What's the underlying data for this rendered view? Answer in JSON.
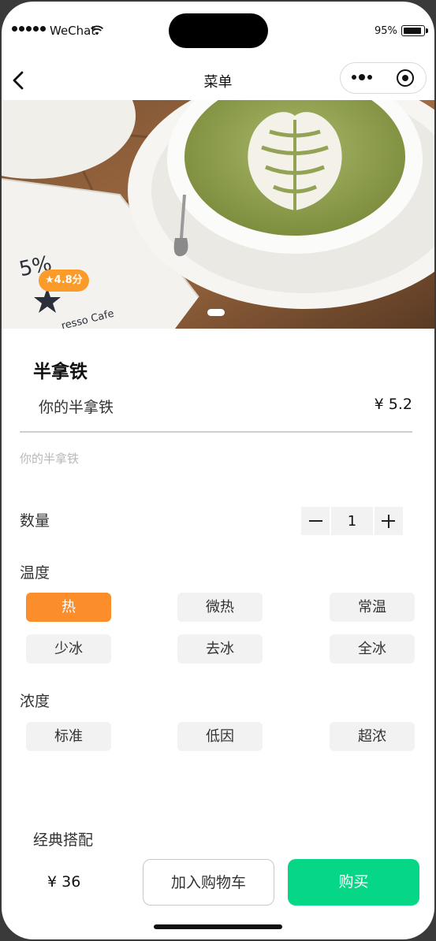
{
  "status_bar": {
    "carrier": "WeChat",
    "battery_percent": "95%",
    "battery_level": 0.95
  },
  "nav": {
    "title": "菜单"
  },
  "hero": {
    "rating": "★4.8分",
    "slide_count": 1,
    "active_slide": 1
  },
  "product": {
    "name": "半拿铁",
    "subtitle": "你的半拿铁",
    "price": "¥ 5.2",
    "description": "你的半拿铁"
  },
  "quantity": {
    "label": "数量",
    "value": "1"
  },
  "temperature": {
    "label": "温度",
    "options": [
      "热",
      "微热",
      "常温",
      "少冰",
      "去冰",
      "全冰"
    ],
    "selected": "热"
  },
  "concentration": {
    "label": "浓度",
    "options": [
      "标准",
      "低因",
      "超浓"
    ]
  },
  "combo": {
    "label": "经典搭配"
  },
  "bottom_bar": {
    "total": "¥  36",
    "add_to_cart": "加入购物车",
    "buy": "购买"
  },
  "colors": {
    "accent_orange": "#fb8e2a",
    "buy_green": "#06d786",
    "rating_orange": "#fb9b2a"
  }
}
